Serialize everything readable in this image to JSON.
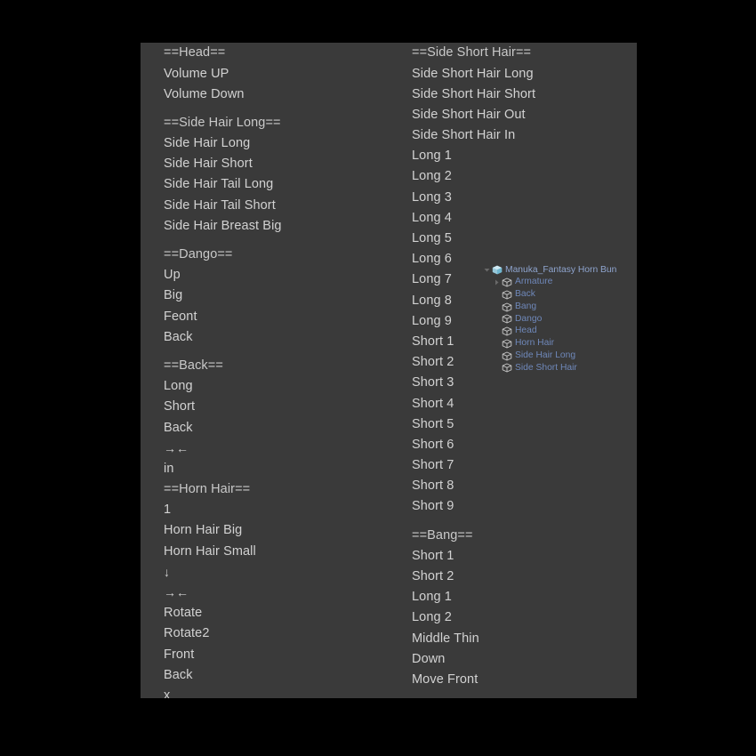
{
  "window": {
    "background_color": "#000000",
    "panel_color": "#3a3a3a",
    "menu_text_color": "#d2d2d2",
    "outliner_text_color": "#6f88ba",
    "collection_icon_color": "#9fd5e8"
  },
  "menu": {
    "left_column": [
      {
        "label": "==Head==",
        "type": "header",
        "gap_above": false
      },
      {
        "label": "Volume UP",
        "type": "item",
        "gap_above": false
      },
      {
        "label": "Volume Down",
        "type": "item",
        "gap_above": false
      },
      {
        "label": "==Side Hair Long==",
        "type": "header",
        "gap_above": true
      },
      {
        "label": "Side Hair Long",
        "type": "item",
        "gap_above": false
      },
      {
        "label": "Side Hair Short",
        "type": "item",
        "gap_above": false
      },
      {
        "label": "Side Hair Tail Long",
        "type": "item",
        "gap_above": false
      },
      {
        "label": "Side Hair Tail Short",
        "type": "item",
        "gap_above": false
      },
      {
        "label": "Side Hair Breast Big",
        "type": "item",
        "gap_above": false
      },
      {
        "label": "==Dango==",
        "type": "header",
        "gap_above": true
      },
      {
        "label": "Up",
        "type": "item",
        "gap_above": false
      },
      {
        "label": "Big",
        "type": "item",
        "gap_above": false
      },
      {
        "label": "Feont",
        "type": "item",
        "gap_above": false
      },
      {
        "label": "Back",
        "type": "item",
        "gap_above": false
      },
      {
        "label": "==Back==",
        "type": "header",
        "gap_above": true
      },
      {
        "label": "Long",
        "type": "item",
        "gap_above": false
      },
      {
        "label": "Short",
        "type": "item",
        "gap_above": false
      },
      {
        "label": "Back",
        "type": "item",
        "gap_above": false
      },
      {
        "label": "→←",
        "type": "glyph",
        "gap_above": false
      },
      {
        "label": "in",
        "type": "item",
        "gap_above": false
      },
      {
        "label": "==Horn Hair==",
        "type": "header",
        "gap_above": false
      },
      {
        "label": "1",
        "type": "item",
        "gap_above": false
      },
      {
        "label": "Horn Hair Big",
        "type": "item",
        "gap_above": false
      },
      {
        "label": "Horn Hair Small",
        "type": "item",
        "gap_above": false
      },
      {
        "label": "↓",
        "type": "glyph",
        "gap_above": false
      },
      {
        "label": "→←",
        "type": "glyph",
        "gap_above": false
      },
      {
        "label": "Rotate",
        "type": "item",
        "gap_above": false
      },
      {
        "label": "Rotate2",
        "type": "item",
        "gap_above": false
      },
      {
        "label": "Front",
        "type": "item",
        "gap_above": false
      },
      {
        "label": "Back",
        "type": "item",
        "gap_above": false
      },
      {
        "label": "x",
        "type": "item",
        "gap_above": false
      }
    ],
    "right_column": [
      {
        "label": "==Side Short Hair==",
        "type": "header",
        "gap_above": false
      },
      {
        "label": "Side Short Hair Long",
        "type": "item",
        "gap_above": false
      },
      {
        "label": "Side Short Hair Short",
        "type": "item",
        "gap_above": false
      },
      {
        "label": "Side Short Hair Out",
        "type": "item",
        "gap_above": false
      },
      {
        "label": "Side Short Hair In",
        "type": "item",
        "gap_above": false
      },
      {
        "label": "Long 1",
        "type": "item",
        "gap_above": false
      },
      {
        "label": "Long 2",
        "type": "item",
        "gap_above": false
      },
      {
        "label": "Long 3",
        "type": "item",
        "gap_above": false
      },
      {
        "label": "Long 4",
        "type": "item",
        "gap_above": false
      },
      {
        "label": "Long 5",
        "type": "item",
        "gap_above": false
      },
      {
        "label": "Long 6",
        "type": "item",
        "gap_above": false
      },
      {
        "label": "Long 7",
        "type": "item",
        "gap_above": false
      },
      {
        "label": "Long 8",
        "type": "item",
        "gap_above": false
      },
      {
        "label": "Long 9",
        "type": "item",
        "gap_above": false
      },
      {
        "label": "Short 1",
        "type": "item",
        "gap_above": false
      },
      {
        "label": "Short 2",
        "type": "item",
        "gap_above": false
      },
      {
        "label": "Short 3",
        "type": "item",
        "gap_above": false
      },
      {
        "label": "Short 4",
        "type": "item",
        "gap_above": false
      },
      {
        "label": "Short 5",
        "type": "item",
        "gap_above": false
      },
      {
        "label": "Short 6",
        "type": "item",
        "gap_above": false
      },
      {
        "label": "Short 7",
        "type": "item",
        "gap_above": false
      },
      {
        "label": "Short 8",
        "type": "item",
        "gap_above": false
      },
      {
        "label": "Short 9",
        "type": "item",
        "gap_above": false
      },
      {
        "label": "==Bang==",
        "type": "header",
        "gap_above": true
      },
      {
        "label": "Short 1",
        "type": "item",
        "gap_above": false
      },
      {
        "label": "Short 2",
        "type": "item",
        "gap_above": false
      },
      {
        "label": "Long 1",
        "type": "item",
        "gap_above": false
      },
      {
        "label": "Long 2",
        "type": "item",
        "gap_above": false
      },
      {
        "label": "Middle Thin",
        "type": "item",
        "gap_above": false
      },
      {
        "label": "Down",
        "type": "item",
        "gap_above": false
      },
      {
        "label": "Move Front",
        "type": "item",
        "gap_above": false
      }
    ]
  },
  "outliner": {
    "rows": [
      {
        "label": "Manuka_Fantasy Horn Bun",
        "indent": 0,
        "icon": "collection-icon",
        "disclosure": "expanded",
        "root": true
      },
      {
        "label": "Armature",
        "indent": 1,
        "icon": "object-icon",
        "disclosure": "collapsed",
        "root": false
      },
      {
        "label": "Back",
        "indent": 1,
        "icon": "object-icon",
        "disclosure": "none",
        "root": false
      },
      {
        "label": "Bang",
        "indent": 1,
        "icon": "object-icon",
        "disclosure": "none",
        "root": false
      },
      {
        "label": "Dango",
        "indent": 1,
        "icon": "object-icon",
        "disclosure": "none",
        "root": false
      },
      {
        "label": "Head",
        "indent": 1,
        "icon": "object-icon",
        "disclosure": "none",
        "root": false
      },
      {
        "label": "Horn Hair",
        "indent": 1,
        "icon": "object-icon",
        "disclosure": "none",
        "root": false
      },
      {
        "label": "Side Hair Long",
        "indent": 1,
        "icon": "object-icon",
        "disclosure": "none",
        "root": false
      },
      {
        "label": "Side Short Hair",
        "indent": 1,
        "icon": "object-icon",
        "disclosure": "none",
        "root": false
      }
    ]
  }
}
